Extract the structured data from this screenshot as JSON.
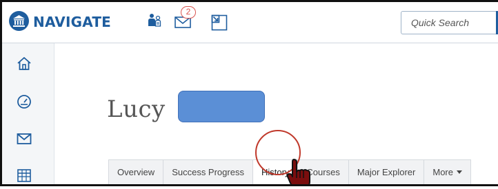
{
  "header": {
    "brand": "NAVIGATE",
    "message_count": "2",
    "search": {
      "placeholder": "Quick Search"
    }
  },
  "icons": {
    "logo": "institution-icon",
    "people": "people-icon",
    "messages": "envelope-icon",
    "quick_add": "quick-add-icon",
    "home": "home-icon",
    "dashboard": "gauge-icon",
    "mail": "mail-icon",
    "calendar": "calendar-icon",
    "cursor": "hand-pointer-icon"
  },
  "student": {
    "first_name": "Lucy"
  },
  "tabs": [
    {
      "label": "Overview"
    },
    {
      "label": "Success Progress"
    },
    {
      "label": "History",
      "active": true
    },
    {
      "label": "Courses"
    },
    {
      "label": "Major Explorer"
    },
    {
      "label": "More"
    }
  ],
  "colors": {
    "brand": "#1e5d9e",
    "highlight_ring": "#c0392b",
    "redaction": "#5b8fd6",
    "badge": "#d9534f"
  }
}
